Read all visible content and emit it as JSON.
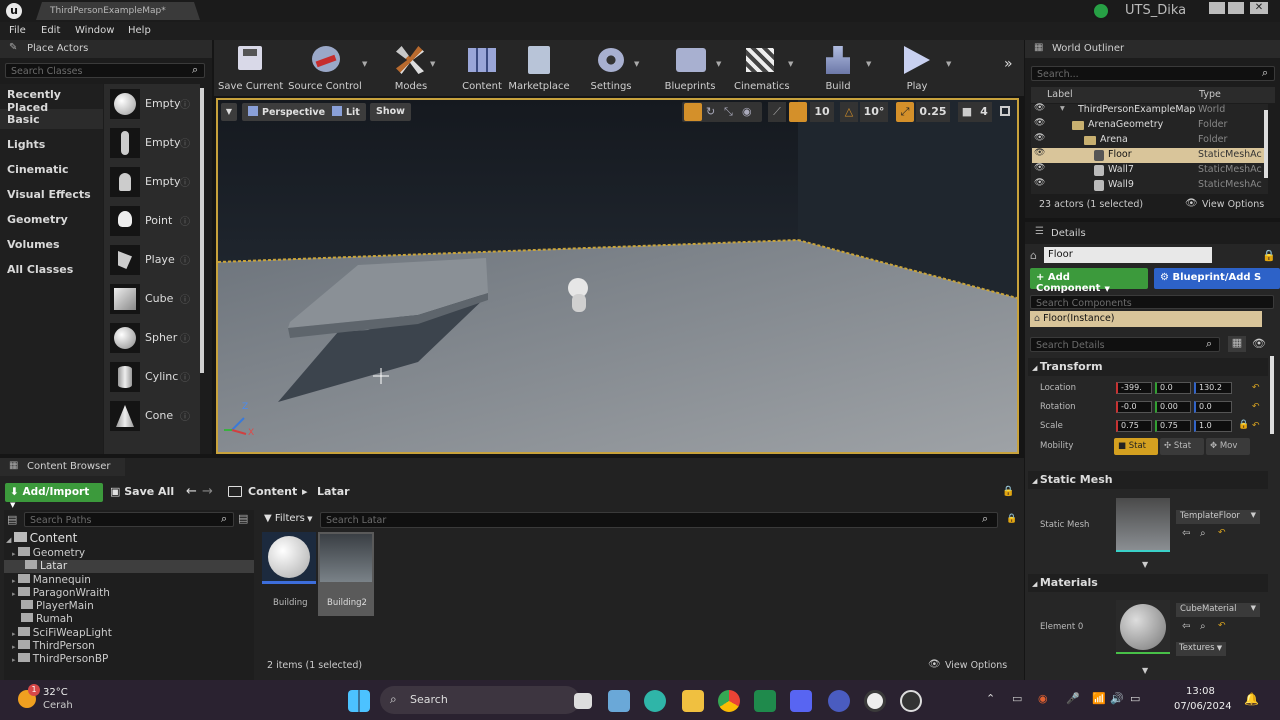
{
  "window": {
    "tab_title": "ThirdPersonExampleMap*",
    "user": "UTS_Dika"
  },
  "menu": [
    "File",
    "Edit",
    "Window",
    "Help"
  ],
  "place_actors": {
    "title": "Place Actors",
    "search_placeholder": "Search Classes",
    "categories": [
      "Recently Placed",
      "Basic",
      "Lights",
      "Cinematic",
      "Visual Effects",
      "Geometry",
      "Volumes",
      "All Classes"
    ],
    "items": [
      "Empty",
      "Empty",
      "Empty",
      "Point",
      "Playe",
      "Cube",
      "Spher",
      "Cylinc",
      "Cone"
    ]
  },
  "toolbar": [
    {
      "label": "Save Current",
      "icon": "save-icon"
    },
    {
      "label": "Source Control",
      "icon": "source-control-icon"
    },
    {
      "label": "Modes",
      "icon": "modes-icon"
    },
    {
      "label": "Content",
      "icon": "content-icon"
    },
    {
      "label": "Marketplace",
      "icon": "marketplace-icon"
    },
    {
      "label": "Settings",
      "icon": "settings-icon"
    },
    {
      "label": "Blueprints",
      "icon": "blueprints-icon"
    },
    {
      "label": "Cinematics",
      "icon": "cinematics-icon"
    },
    {
      "label": "Build",
      "icon": "build-icon"
    },
    {
      "label": "Play",
      "icon": "play-icon"
    }
  ],
  "viewport": {
    "perspective": "Perspective",
    "lit": "Lit",
    "show": "Show",
    "grid": "10",
    "angle": "10°",
    "scale": "0.25",
    "cam_speed": "4",
    "axes": {
      "z": "Z",
      "x": "X"
    }
  },
  "outliner": {
    "title": "World Outliner",
    "search_placeholder": "Search...",
    "col_label": "Label",
    "col_type": "Type",
    "rows": [
      {
        "label": "ThirdPersonExampleMap",
        "type": "World"
      },
      {
        "label": "ArenaGeometry",
        "type": "Folder"
      },
      {
        "label": "Arena",
        "type": "Folder"
      },
      {
        "label": "Floor",
        "type": "StaticMeshAc"
      },
      {
        "label": "Wall7",
        "type": "StaticMeshAc"
      },
      {
        "label": "Wall9",
        "type": "StaticMeshAc"
      }
    ],
    "count": "23 actors (1 selected)",
    "view_options": "View Options"
  },
  "details": {
    "title": "Details",
    "name": "Floor",
    "add_component": "+ Add Component",
    "blueprint": "Blueprint/Add S",
    "search_components": "Search Components",
    "instance": "Floor(Instance)",
    "search_details": "Search Details",
    "transform": "Transform",
    "location": "Location",
    "rotation": "Rotation",
    "scale": "Scale",
    "mobility": "Mobility",
    "loc": [
      "-399.",
      "0.0",
      "130.2"
    ],
    "rot": [
      "-0.0",
      "0.00",
      "0.0"
    ],
    "scl": [
      "0.75",
      "0.75",
      "1.0"
    ],
    "mob": [
      "Stat",
      "Stat",
      "Mov"
    ],
    "static_mesh_section": "Static Mesh",
    "static_mesh_label": "Static Mesh",
    "mesh_value": "TemplateFloor",
    "materials_section": "Materials",
    "element": "Element 0",
    "material_value": "CubeMaterial",
    "textures": "Textures"
  },
  "content_browser": {
    "title": "Content Browser",
    "add_import": "Add/Import",
    "save_all": "Save All",
    "path": [
      "Content",
      "Latar"
    ],
    "search_paths": "Search Paths",
    "filters": "Filters",
    "search_latar": "Search Latar",
    "tree": [
      "Content",
      "Geometry",
      "Latar",
      "Mannequin",
      "ParagonWraith",
      "PlayerMain",
      "Rumah",
      "SciFiWeapLight",
      "ThirdPerson",
      "ThirdPersonBP"
    ],
    "assets": [
      "Building",
      "Building2"
    ],
    "status": "2 items (1 selected)",
    "view_options": "View Options"
  },
  "taskbar": {
    "weather_temp": "32°C",
    "weather_desc": "Cerah",
    "search": "Search",
    "time": "13:08",
    "date": "07/06/2024",
    "badge": "1"
  }
}
